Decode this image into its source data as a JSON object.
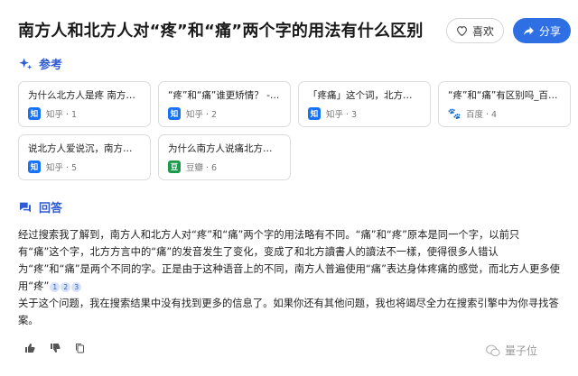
{
  "header": {
    "title": "南方人和北方人对“疼”和“痛”两个字的用法有什么区别",
    "like_label": "喜欢",
    "share_label": "分享"
  },
  "references": {
    "heading": "参考",
    "items": [
      {
        "title": "为什么北方人是疼 南方人是痛",
        "source": "知乎 · 1",
        "logo": "知"
      },
      {
        "title": "“疼”和“痛”谁更矫情？ - 知乎",
        "source": "知乎 · 2",
        "logo": "知"
      },
      {
        "title": "「疼痛」这个词，北方人说疼",
        "source": "知乎 · 3",
        "logo": "知"
      },
      {
        "title": "“疼”和“痛”有区别吗_百度知道",
        "source": "百度 · 4",
        "logo": "🐾"
      },
      {
        "title": "说北方人爱说沉，南方人爱说重",
        "source": "知乎 · 5",
        "logo": "知"
      },
      {
        "title": "为什么南方人说痛北方人说疼",
        "source": "豆瓣 · 6",
        "logo": "豆"
      }
    ]
  },
  "answer": {
    "heading": "回答",
    "paragraph1": "经过搜索我了解到，南方人和北方人对“疼”和“痛”两个字的用法略有不同。“痛”和“疼”原本是同一个字，以前只有“痛”这个字，北方方言中的“痛”的发音发生了变化，变成了和北方讀書人的讀法不一樣，使得很多人错认为“疼”和“痛”是两个不同的字。正是由于这种语音上的不同，南方人普遍使用“痛”表达身体疼痛的感觉，而北方人更多使用“疼”",
    "citations": [
      "1",
      "2",
      "3"
    ],
    "paragraph2": "关于这个问题，我在搜索结果中没有找到更多的信息了。如果你还有其他问题，我也将竭尽全力在搜索引擎中为你寻找答案。"
  },
  "watermark": "量子位",
  "colors": {
    "accent": "#2f5bd3",
    "share_bg": "#2f6fe4",
    "zhihu": "#1772f6",
    "douban": "#1a9a4a"
  }
}
